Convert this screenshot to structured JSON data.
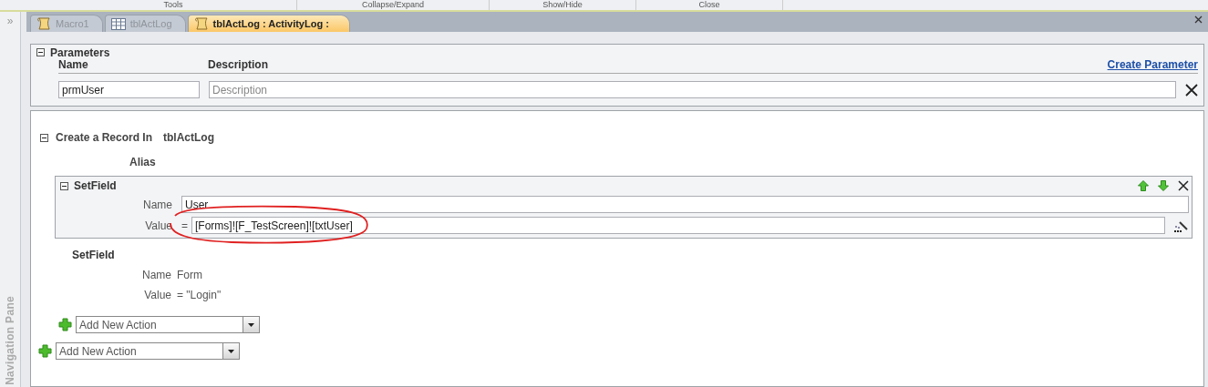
{
  "ribbon_groups": [
    "Tools",
    "Collapse/Expand",
    "Show/Hide",
    "Close"
  ],
  "nav_pane": {
    "toggle": "»",
    "label": "Navigation Pane"
  },
  "tabs": [
    {
      "label": "Macro1",
      "kind": "macro",
      "selected": false
    },
    {
      "label": "tblActLog",
      "kind": "table",
      "selected": false
    },
    {
      "label": "tblActLog : ActivityLog :",
      "kind": "macro",
      "selected": true
    }
  ],
  "parameters": {
    "title": "Parameters",
    "expanded": true,
    "columns": [
      "Name",
      "Description"
    ],
    "link": "Create Parameter",
    "rows": [
      {
        "name": "prmUser",
        "description_placeholder": "Description"
      }
    ]
  },
  "block": {
    "title": "Create a Record In",
    "table": "tblActLog",
    "expanded": true,
    "alias_label": "Alias",
    "actions": [
      {
        "title": "SetField",
        "selected": true,
        "fields": [
          {
            "label": "Name",
            "value": "User"
          },
          {
            "label": "Value",
            "prefix": "=",
            "value": "[Forms]![F_TestScreen]![txtUser]",
            "highlight": {
              "kind": "ellipse"
            }
          }
        ]
      },
      {
        "title": "SetField",
        "selected": false,
        "fields": [
          {
            "label": "Name",
            "value": "Form"
          },
          {
            "label": "Value",
            "value": "= \"Login\""
          }
        ]
      }
    ],
    "add_action": "Add New Action"
  },
  "add_action": "Add New Action"
}
